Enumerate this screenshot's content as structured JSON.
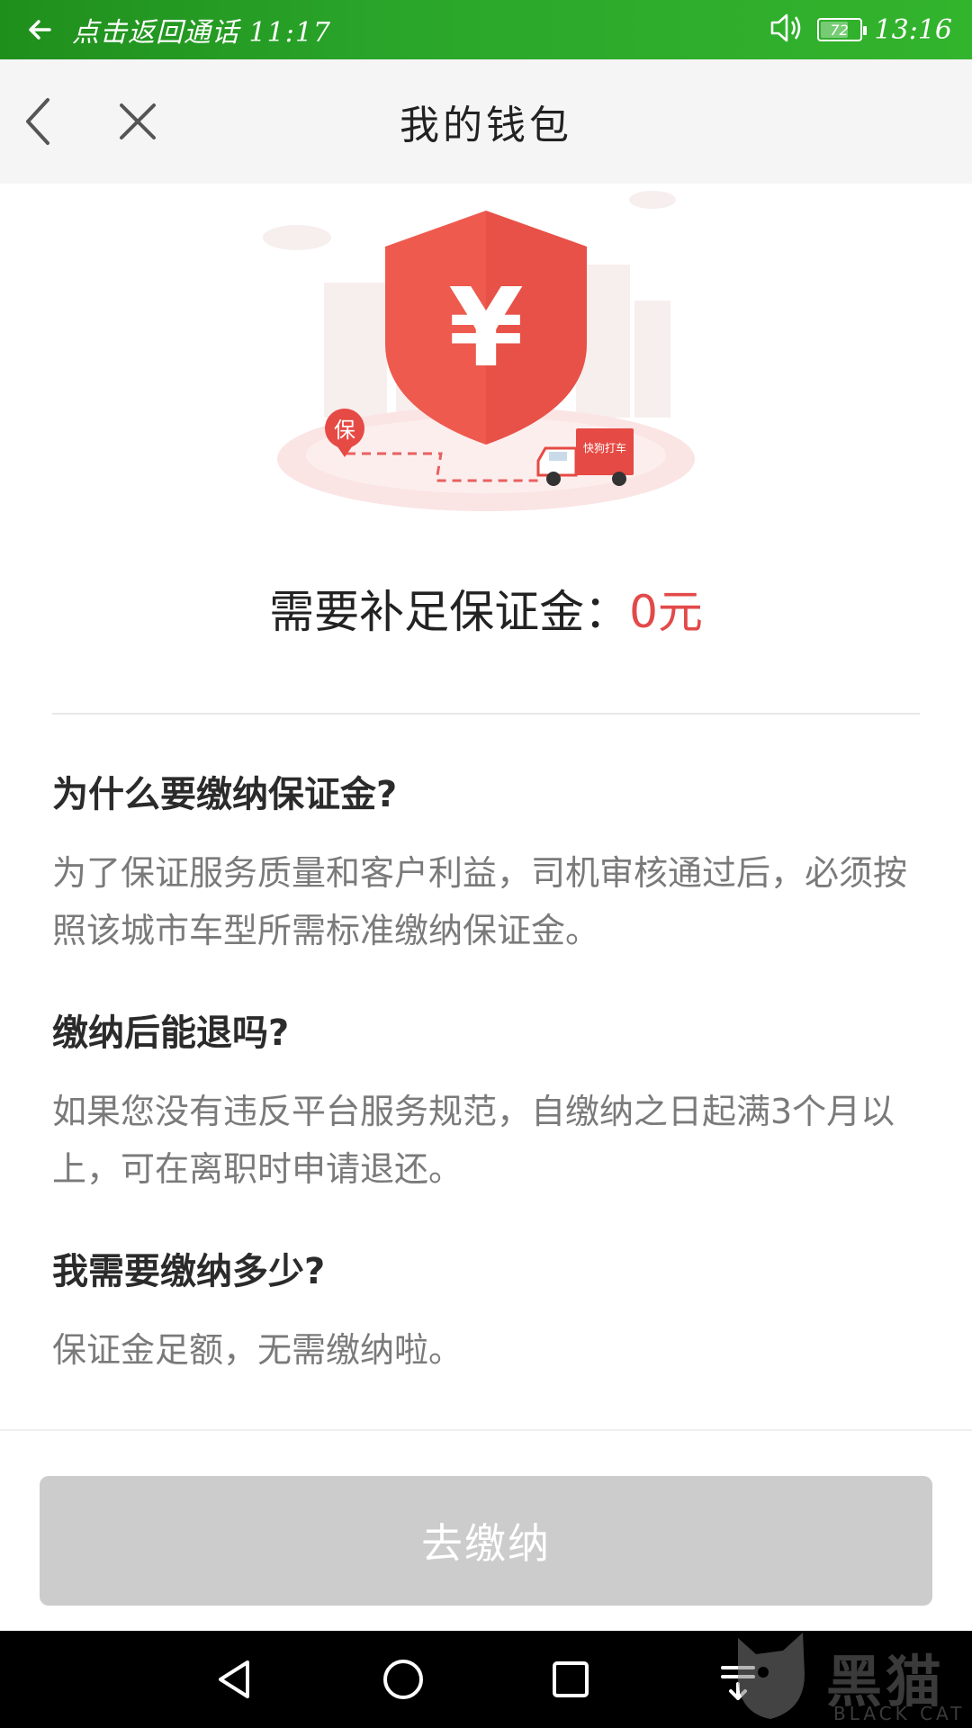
{
  "status_bar": {
    "call_text": "点击返回通话 11:17",
    "battery_level": "72",
    "battery_fraction": 0.72,
    "time": "13:16"
  },
  "nav": {
    "title": "我的钱包"
  },
  "hero": {
    "shield_symbol": "¥",
    "marker_label": "保",
    "truck_label": "快狗打车"
  },
  "deposit": {
    "label": "需要补足保证金：",
    "amount": "0元"
  },
  "faq": [
    {
      "question": "为什么要缴纳保证金?",
      "answer": "为了保证服务质量和客户利益，司机审核通过后，必须按照该城市车型所需标准缴纳保证金。"
    },
    {
      "question": "缴纳后能退吗?",
      "answer": "如果您没有违反平台服务规范，自缴纳之日起满3个月以上，可在离职时申请退还。"
    },
    {
      "question": "我需要缴纳多少?",
      "answer": "保证金足额，无需缴纳啦。"
    }
  ],
  "action": {
    "pay_label": "去缴纳"
  },
  "watermark": {
    "text": "黑猫",
    "sub": "BLACK CAT"
  },
  "colors": {
    "status_green": "#2aa52a",
    "accent_red": "#e24a4a",
    "button_disabled": "#cccccc"
  }
}
